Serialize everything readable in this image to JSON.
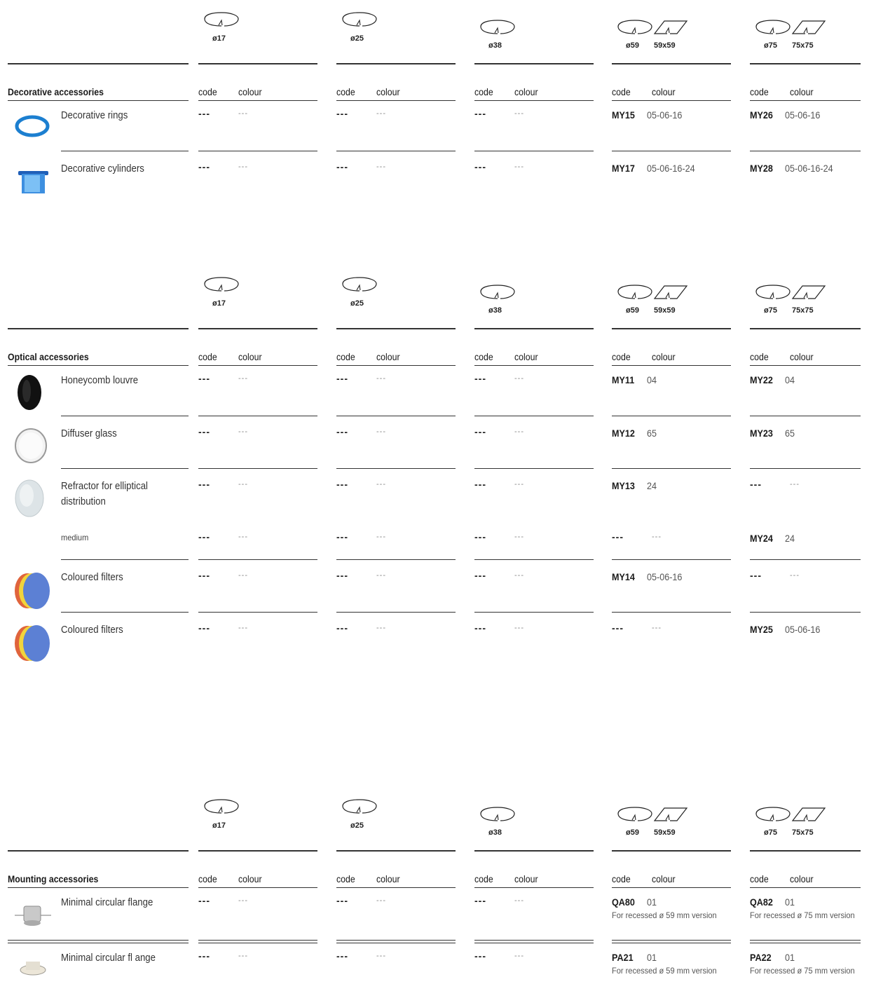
{
  "sizes": {
    "d17": "ø17",
    "d25": "ø25",
    "d38": "ø38",
    "d59": "ø59",
    "s59": "59x59",
    "d75": "ø75",
    "s75": "75x75"
  },
  "headers": {
    "code": "code",
    "colour": "colour"
  },
  "dash": {
    "code": "---",
    "colour": "---"
  },
  "decorative": {
    "title": "Decorative accessories",
    "items": [
      {
        "name": "Decorative rings",
        "icon": "blue-ring-icon",
        "my59_code": "MY15",
        "my59_colour": "05-06-16",
        "my75_code": "MY26",
        "my75_colour": "05-06-16"
      },
      {
        "name": "Decorative cylinders",
        "icon": "blue-cylinder-icon",
        "my59_code": "MY17",
        "my59_colour": "05-06-16-24",
        "my75_code": "MY28",
        "my75_colour": "05-06-16-24"
      }
    ]
  },
  "optical": {
    "title": "Optical accessories",
    "items": [
      {
        "name": "Honeycomb louvre",
        "icon": "honeycomb-louvre-icon",
        "my59_code": "MY11",
        "my59_colour": "04",
        "my75_code": "MY22",
        "my75_colour": "04"
      },
      {
        "name": "Diffuser glass",
        "icon": "diffuser-glass-icon",
        "my59_code": "MY12",
        "my59_colour": "65",
        "my75_code": "MY23",
        "my75_colour": "65"
      },
      {
        "name": "Refractor for elliptical distribution",
        "icon": "refractor-icon",
        "my59_code": "MY13",
        "my59_colour": "24"
      },
      {
        "sub": "medium",
        "my75_code": "MY24",
        "my75_colour": "24"
      },
      {
        "name": "Coloured filters",
        "icon": "coloured-filters-icon",
        "my59_code": "MY14",
        "my59_colour": "05-06-16"
      },
      {
        "name": "Coloured filters",
        "icon": "coloured-filters-icon",
        "my75_code": "MY25",
        "my75_colour": "05-06-16"
      }
    ]
  },
  "mounting": {
    "title": "Mounting accessories",
    "items": [
      {
        "name": "Minimal circular flange",
        "icon": "circular-flange-icon",
        "my59_code": "QA80",
        "my59_colour": "01",
        "my59_note": "For recessed ø 59 mm version",
        "my75_code": "QA82",
        "my75_colour": "01",
        "my75_note": "For recessed ø 75 mm version"
      },
      {
        "name": "Minimal circular fl ange",
        "icon": "circular-flange-white-icon",
        "my59_code": "PA21",
        "my59_colour": "01",
        "my59_note": "For recessed ø 59 mm version",
        "my75_code": "PA22",
        "my75_colour": "01",
        "my75_note": "For recessed ø 75 mm version"
      }
    ]
  }
}
